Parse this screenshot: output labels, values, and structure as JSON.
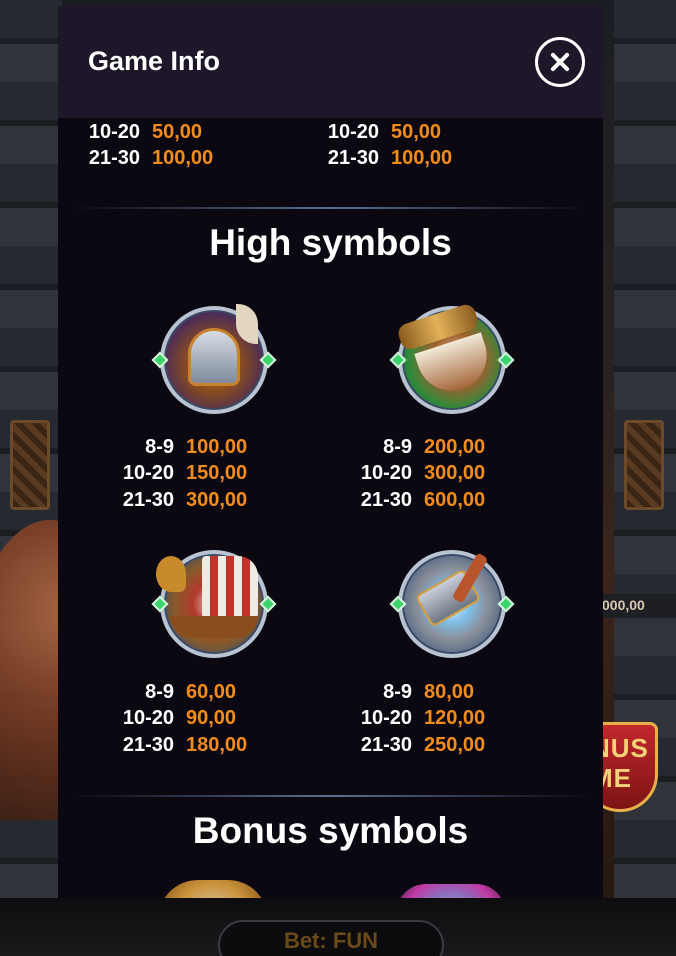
{
  "modal": {
    "title": "Game Info",
    "close_label": "close"
  },
  "top_paytable": {
    "left": [
      {
        "count": "10-20",
        "value": "50,00"
      },
      {
        "count": "21-30",
        "value": "100,00"
      }
    ],
    "right": [
      {
        "count": "10-20",
        "value": "50,00"
      },
      {
        "count": "21-30",
        "value": "100,00"
      }
    ]
  },
  "high_symbols": {
    "title": "High symbols",
    "items": [
      {
        "icon": "viking-helmet-icon",
        "pays": [
          {
            "count": "8-9",
            "value": "100,00"
          },
          {
            "count": "10-20",
            "value": "150,00"
          },
          {
            "count": "21-30",
            "value": "300,00"
          }
        ]
      },
      {
        "icon": "drinking-horn-icon",
        "pays": [
          {
            "count": "8-9",
            "value": "200,00"
          },
          {
            "count": "10-20",
            "value": "300,00"
          },
          {
            "count": "21-30",
            "value": "600,00"
          }
        ]
      },
      {
        "icon": "viking-ship-icon",
        "pays": [
          {
            "count": "8-9",
            "value": "60,00"
          },
          {
            "count": "10-20",
            "value": "90,00"
          },
          {
            "count": "21-30",
            "value": "180,00"
          }
        ]
      },
      {
        "icon": "war-hammer-icon",
        "pays": [
          {
            "count": "8-9",
            "value": "80,00"
          },
          {
            "count": "10-20",
            "value": "120,00"
          },
          {
            "count": "21-30",
            "value": "250,00"
          }
        ]
      }
    ]
  },
  "bonus_symbols": {
    "title": "Bonus symbols"
  },
  "background": {
    "side_meter": "000,00",
    "bonus_badge": "NUS ME",
    "bet_label": "Bet: FUN"
  },
  "colors": {
    "value_orange": "#f28c1c",
    "header_bg": "#1e1729",
    "panel_bg": "#0c0812"
  }
}
